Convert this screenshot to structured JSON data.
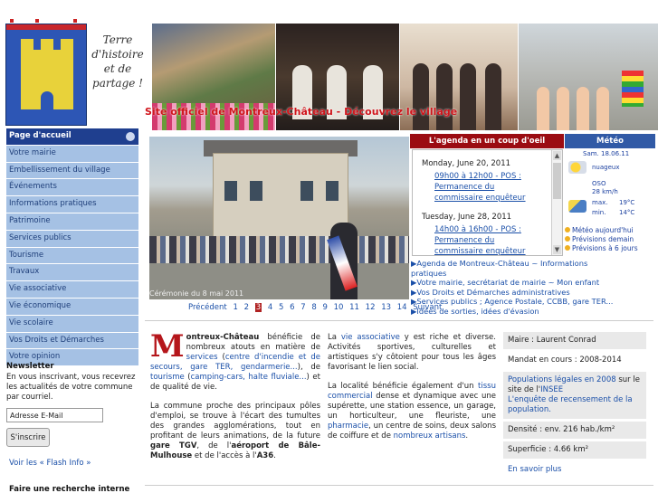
{
  "header": {
    "motto_lines": [
      "Terre",
      "d'histoire",
      "et de",
      "partage !"
    ],
    "tagline": "Site officiel de Montreux-Château - Découvrez le village"
  },
  "sidebar": {
    "items": [
      {
        "label": "Page d'accueil"
      },
      {
        "label": "Votre mairie"
      },
      {
        "label": "Embellissement du village"
      },
      {
        "label": "Événements"
      },
      {
        "label": "Informations pratiques"
      },
      {
        "label": "Patrimoine"
      },
      {
        "label": "Services publics"
      },
      {
        "label": "Tourisme"
      },
      {
        "label": "Travaux"
      },
      {
        "label": "Vie associative"
      },
      {
        "label": "Vie économique"
      },
      {
        "label": "Vie scolaire"
      },
      {
        "label": "Vos Droits et Démarches"
      },
      {
        "label": "Votre opinion"
      }
    ]
  },
  "newsletter": {
    "title": "Newsletter",
    "text": "En vous inscrivant, vous recevrez les actualités de votre commune par courriel.",
    "placeholder": "Adresse E-Mail",
    "button": "S'inscrire",
    "flash_link": "Voir les « Flash Info »",
    "search_title": "Faire une recherche interne"
  },
  "slideshow": {
    "caption": "Cérémonie du 8 mai 2011",
    "prev": "Précédent",
    "pages": [
      "1",
      "2",
      "3",
      "4",
      "5",
      "6",
      "7",
      "8",
      "9",
      "10",
      "11",
      "12",
      "13",
      "14"
    ],
    "current": "3",
    "next": "Suivant"
  },
  "agenda": {
    "title": "L'agenda en un coup d'oeil",
    "events": [
      {
        "date": "Monday, June 20, 2011",
        "lines": [
          "09h00 à 12h00 - POS :",
          "Permanence du",
          "commissaire enquêteur"
        ]
      },
      {
        "date": "Tuesday, June 28, 2011",
        "lines": [
          "14h00 à 16h00 - POS :",
          "Permanence du",
          "commissaire enquêteur"
        ]
      }
    ],
    "links": [
      "▶Agenda de Montreux-Château ~ Informations pratiques",
      "▶Votre mairie, secrétariat de mairie ~ Mon enfant",
      "▶Vos Droits et Démarches administratives",
      "▶Services publics ; Agence Postale, CCBB, gare TER...",
      "▶Idées de sorties, idées d'évasion"
    ]
  },
  "meteo": {
    "title": "Météo",
    "date": "Sam. 18.06.11",
    "condition": "nuageux",
    "wind_dir": "OSO",
    "wind_speed": "28 km/h",
    "max_label": "max.",
    "max_value": "19°C",
    "min_label": "min.",
    "min_value": "14°C",
    "links": [
      "Météo aujourd'hui",
      "Prévisions demain",
      "Prévisions à 6 jours"
    ]
  },
  "content": {
    "col1_p1": {
      "dropcap": "M",
      "bold_start": "ontreux-Château",
      "t1": " bénéficie de nombreux atouts en matière de ",
      "link1": "services",
      "t2": " (",
      "link2": "centre d'incendie et de secours, gare TER, gendarmerie...",
      "t3": "), de ",
      "link3": "tourisme",
      "t4": " (",
      "link4": "camping-cars, halte fluviale...",
      "t5": ") et de qualité de vie."
    },
    "col1_p2": {
      "t1": "La commune proche des principaux pôles d'emploi, se trouve à l'écart des tumultes des grandes agglomérations, tout en profitant de leurs animations, de la future ",
      "b1": "gare TGV",
      "t2": ", de l'",
      "b2": "aéroport de Bâle-Mulhouse",
      "t3": " et de l'accès à l'",
      "b3": "A36",
      "t4": "."
    },
    "col2_p1": {
      "t1": "La ",
      "link1": "vie associative",
      "t2": " y est riche et diverse. Activités sportives, culturelles et artistiques s'y côtoient pour tous les âges favorisant le lien social."
    },
    "col2_p2": {
      "t1": "La localité bénéficie également d'un ",
      "link1": "tissu commercial",
      "t2": " dense et dynamique avec une supérette, une station essence, un garage, un horticulteur, une fleuriste, une ",
      "link2": "pharmacie",
      "t3": ", un centre de soins, deux salons de coiffure et de ",
      "link3": "nombreux artisans",
      "t4": "."
    }
  },
  "info": {
    "maire": "Maire : Laurent Conrad",
    "mandat": "Mandat en cours : 2008-2014",
    "pop_link": "Populations légales en 2008",
    "pop_text": " sur le site de l'",
    "insee": "INSEE",
    "enquete": "L'enquête de recensement de la population.",
    "densite": "Densité : env. 216 hab./km²",
    "superficie": "Superficie : 4.66 km²",
    "more": "En savoir plus"
  }
}
